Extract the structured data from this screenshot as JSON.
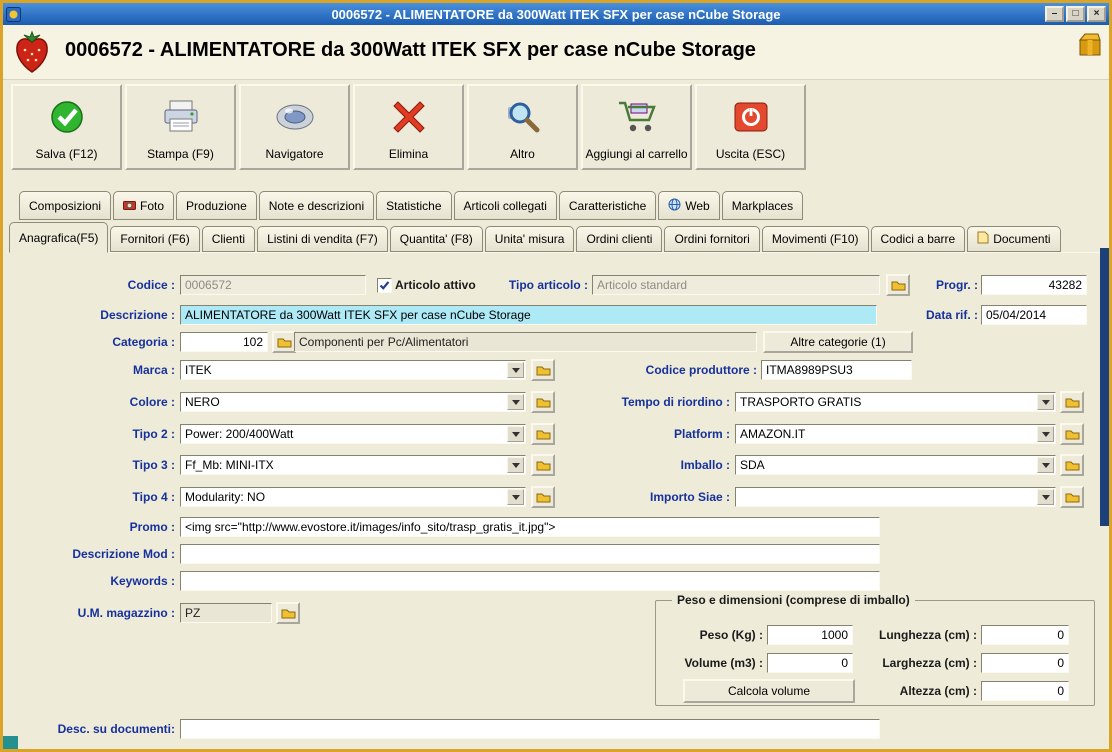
{
  "titlebar": {
    "title": "0006572 - ALIMENTATORE da 300Watt ITEK SFX per case nCube Storage",
    "minimize": "–",
    "maximize": "□",
    "close": "×"
  },
  "header": {
    "title": "0006572 - ALIMENTATORE da 300Watt ITEK SFX per case nCube Storage"
  },
  "toolbar": {
    "save": "Salva (F12)",
    "print": "Stampa (F9)",
    "navigator": "Navigatore",
    "delete": "Elimina",
    "other": "Altro",
    "add_to_cart": "Aggiungi al carrello",
    "exit": "Uscita (ESC)"
  },
  "tabs1": {
    "composizioni": "Composizioni",
    "foto": "Foto",
    "produzione": "Produzione",
    "note": "Note e descrizioni",
    "statistiche": "Statistiche",
    "articoli_collegati": "Articoli collegati",
    "caratteristiche": "Caratteristiche",
    "web": "Web",
    "markplaces": "Markplaces"
  },
  "tabs2": {
    "anagrafica": "Anagrafica(F5)",
    "fornitori": "Fornitori (F6)",
    "clienti": "Clienti",
    "listini": "Listini di vendita (F7)",
    "quantita": "Quantita' (F8)",
    "unita_misura": "Unita' misura",
    "ordini_clienti": "Ordini clienti",
    "ordini_fornitori": "Ordini fornitori",
    "movimenti": "Movimenti (F10)",
    "codici_barre": "Codici a barre",
    "documenti": "Documenti"
  },
  "form": {
    "codice_label": "Codice :",
    "codice_value": "0006572",
    "articolo_attivo_label": "Articolo attivo",
    "tipo_articolo_label": "Tipo articolo :",
    "tipo_articolo_value": "Articolo standard",
    "progr_label": "Progr. :",
    "progr_value": "43282",
    "descrizione_label": "Descrizione :",
    "descrizione_value": "ALIMENTATORE da 300Watt ITEK SFX per case nCube Storage",
    "data_rif_label": "Data rif. :",
    "data_rif_value": "05/04/2014",
    "categoria_label": "Categoria :",
    "categoria_code": "102",
    "categoria_desc": "Componenti per Pc/Alimentatori",
    "altre_categorie_button": "Altre categorie (1)",
    "marca_label": "Marca :",
    "marca_value": "ITEK",
    "codice_produttore_label": "Codice produttore :",
    "codice_produttore_value": "ITMA8989PSU3",
    "colore_label": "Colore :",
    "colore_value": "NERO",
    "tempo_riordino_label": "Tempo di riordino :",
    "tempo_riordino_value": "TRASPORTO GRATIS",
    "tipo2_label": "Tipo 2 :",
    "tipo2_value": "Power: 200/400Watt",
    "platform_label": "Platform :",
    "platform_value": "AMAZON.IT",
    "tipo3_label": "Tipo 3 :",
    "tipo3_value": "Ff_Mb: MINI-ITX",
    "imballo_label": "Imballo :",
    "imballo_value": "SDA",
    "tipo4_label": "Tipo 4 :",
    "tipo4_value": "Modularity: NO",
    "importo_siae_label": "Importo Siae :",
    "importo_siae_value": "",
    "promo_label": "Promo :",
    "promo_value": "<img src=\"http://www.evostore.it/images/info_sito/trasp_gratis_it.jpg\">",
    "descrizione_mod_label": "Descrizione Mod :",
    "descrizione_mod_value": "",
    "keywords_label": "Keywords :",
    "keywords_value": "",
    "um_magazzino_label": "U.M. magazzino :",
    "um_magazzino_value": "PZ",
    "desc_documenti_label": "Desc. su documenti:",
    "desc_documenti_value": ""
  },
  "peso_box": {
    "title": "Peso e dimensioni (comprese di imballo)",
    "peso_label": "Peso (Kg) :",
    "peso_value": "1000",
    "volume_label": "Volume (m3) :",
    "volume_value": "0",
    "calcola_button": "Calcola volume",
    "lunghezza_label": "Lunghezza (cm) :",
    "lunghezza_value": "0",
    "larghezza_label": "Larghezza (cm) :",
    "larghezza_value": "0",
    "altezza_label": "Altezza (cm) :",
    "altezza_value": "0"
  },
  "icons": {
    "app": "strawberry-icon",
    "header_right": "gold-box-icon",
    "save": "green-check-circle-icon",
    "print": "printer-icon",
    "navigator": "navigator-orb-icon",
    "delete": "red-x-icon",
    "other": "magnifier-icon",
    "cart": "shopping-cart-icon",
    "exit": "power-stop-icon",
    "lookup": "folder-icon"
  },
  "colors": {
    "titlebar_blue": "#1b5cb0",
    "window_border_gold": "#d9a428",
    "background_beige": "#eeebd9",
    "label_blue": "#16319c",
    "description_highlight": "#aee9f6",
    "edge_navy": "#1d4078",
    "corner_teal": "#259090"
  }
}
